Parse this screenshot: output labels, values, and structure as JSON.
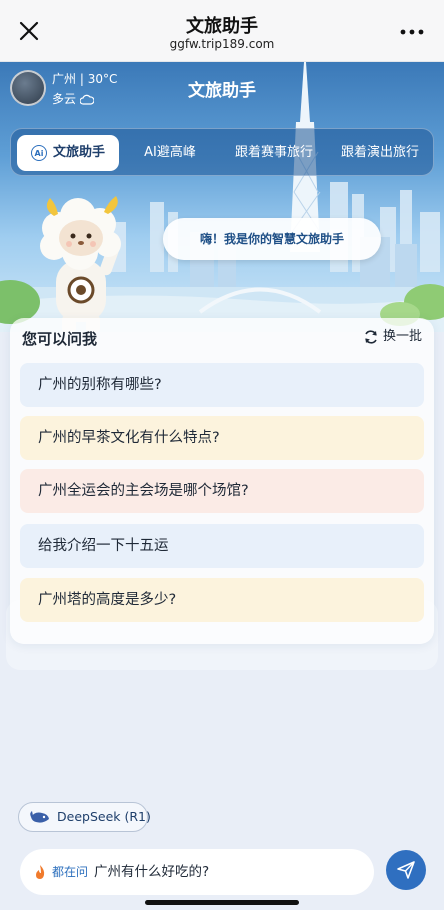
{
  "nav": {
    "title": "文旅助手",
    "url": "ggfw.trip189.com",
    "close_icon": "close-icon",
    "more_icon": "more-icon"
  },
  "hero": {
    "title": "文旅助手",
    "weather": {
      "city": "广州",
      "temp": "30°C",
      "separator": "|",
      "condition": "多云",
      "condition_icon": "cloud-icon"
    },
    "tabs": [
      {
        "label": "文旅助手",
        "icon": "ai-icon",
        "active": true
      },
      {
        "label": "AI避高峰",
        "active": false
      },
      {
        "label": "跟着赛事旅行",
        "active": false
      },
      {
        "label": "跟着演出旅行",
        "active": false
      }
    ],
    "greeting": "嗨！我是你的智慧文旅助手"
  },
  "suggestions": {
    "title": "您可以问我",
    "refresh_label": "换一批",
    "items": [
      "广州的别称有哪些?",
      "广州的早茶文化有什么特点?",
      "广州全运会的主会场是哪个场馆?",
      "给我介绍一下十五运",
      "广州塔的高度是多少?"
    ]
  },
  "model": {
    "label": "DeepSeek (R1)",
    "icon": "whale-icon"
  },
  "input": {
    "prefix": "都在问",
    "placeholder": "广州有什么好吃的?",
    "send_icon": "send-icon"
  },
  "colors": {
    "accent": "#2f6fc0",
    "tab_bar": "#1e5596",
    "item_blue": "#e8f0fa",
    "item_yellow": "#fcf3dd",
    "item_pink": "#fbebe6"
  }
}
